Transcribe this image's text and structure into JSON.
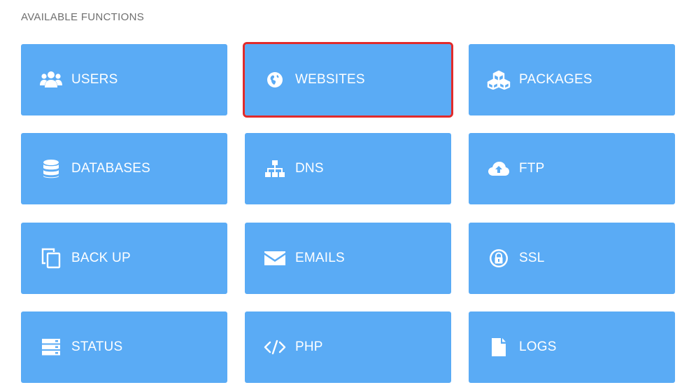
{
  "section": {
    "title": "AVAILABLE FUNCTIONS"
  },
  "colors": {
    "tile_background": "#5aabf5",
    "tile_text": "#ffffff",
    "highlight_border": "#e12b2b"
  },
  "tiles": [
    {
      "label": "USERS",
      "icon": "users-icon"
    },
    {
      "label": "WEBSITES",
      "icon": "globe-icon",
      "highlighted": true
    },
    {
      "label": "PACKAGES",
      "icon": "cubes-icon"
    },
    {
      "label": "DATABASES",
      "icon": "database-icon"
    },
    {
      "label": "DNS",
      "icon": "sitemap-icon"
    },
    {
      "label": "FTP",
      "icon": "cloud-upload-icon"
    },
    {
      "label": "BACK UP",
      "icon": "copy-icon"
    },
    {
      "label": "EMAILS",
      "icon": "envelope-icon"
    },
    {
      "label": "SSL",
      "icon": "lock-icon"
    },
    {
      "label": "STATUS",
      "icon": "server-icon"
    },
    {
      "label": "PHP",
      "icon": "code-icon"
    },
    {
      "label": "LOGS",
      "icon": "file-icon"
    }
  ]
}
